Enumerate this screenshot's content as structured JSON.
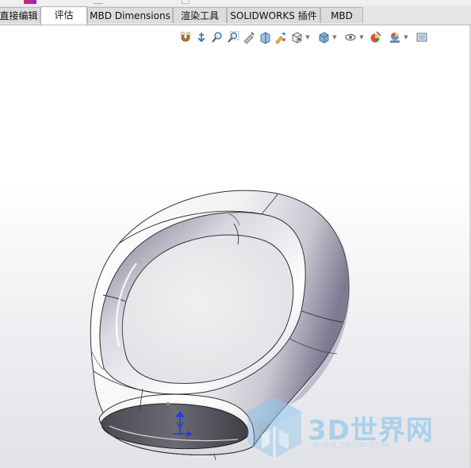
{
  "tabs": [
    {
      "label": "直接编辑",
      "active": false
    },
    {
      "label": "评估",
      "active": true
    },
    {
      "label": "MBD Dimensions",
      "active": false
    },
    {
      "label": "渲染工具",
      "active": false
    },
    {
      "label": "SOLIDWORKS 插件",
      "active": false
    },
    {
      "label": "MBD",
      "active": false
    }
  ],
  "heads_up_toolbar": [
    {
      "icon": "magnet-icon"
    },
    {
      "icon": "anchor-icon"
    },
    {
      "icon": "zoom-to-fit-icon"
    },
    {
      "icon": "zoom-area-icon"
    },
    {
      "icon": "previous-view-icon"
    },
    {
      "icon": "section-view-icon"
    },
    {
      "icon": "dynamic-annotation-icon"
    },
    {
      "icon": "view-orientation-icon",
      "dropdown": true
    },
    {
      "icon": "display-style-icon",
      "dropdown": true
    },
    {
      "icon": "hide-show-items-icon",
      "dropdown": true
    },
    {
      "icon": "edit-appearance-icon"
    },
    {
      "icon": "apply-scene-icon",
      "dropdown": true
    },
    {
      "icon": "view-settings-icon"
    }
  ],
  "watermark": {
    "text": "3D世界网",
    "subtext": "WWW.3DSJW.COM",
    "color": "#78bee8"
  },
  "colors": {
    "tab_bg": "#dcdcdc",
    "active_tab_bg": "#ffffff",
    "viewport_bottom": "#e2e3e8",
    "model_highlight": "#ffffff",
    "model_shadow": "#7a7a86"
  }
}
